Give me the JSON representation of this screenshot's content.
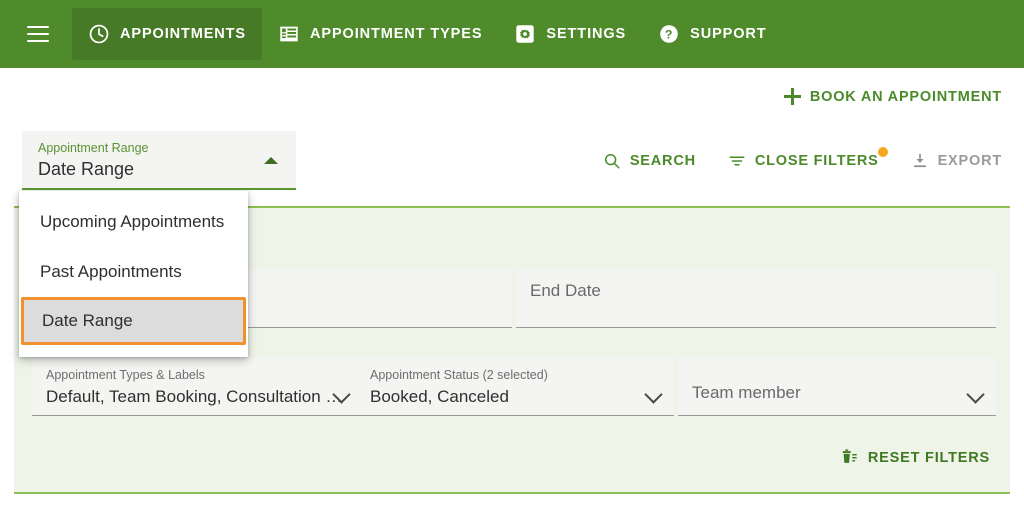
{
  "topnav": {
    "menu_icon": "hamburger-icon",
    "items": [
      {
        "label": "APPOINTMENTS",
        "icon": "clock-icon",
        "active": true
      },
      {
        "label": "APPOINTMENT TYPES",
        "icon": "list-icon",
        "active": false
      },
      {
        "label": "SETTINGS",
        "icon": "gear-icon",
        "active": false
      },
      {
        "label": "SUPPORT",
        "icon": "question-circle-icon",
        "active": false
      }
    ]
  },
  "actions": {
    "book": {
      "label": "BOOK AN APPOINTMENT",
      "icon": "plus-icon"
    },
    "search": {
      "label": "SEARCH",
      "icon": "search-icon"
    },
    "close_filters": {
      "label": "CLOSE FILTERS",
      "icon": "filter-icon",
      "badge": true
    },
    "export": {
      "label": "EXPORT",
      "icon": "download-icon",
      "disabled": true
    },
    "reset_filters": {
      "label": "RESET FILTERS",
      "icon": "trash-list-icon"
    }
  },
  "range_select": {
    "label": "Appointment Range",
    "value": "Date Range",
    "expanded": true,
    "caret_icon": "caret-up-icon",
    "options": [
      {
        "label": "Upcoming Appointments",
        "selected": false
      },
      {
        "label": "Past Appointments",
        "selected": false
      },
      {
        "label": "Date Range",
        "selected": true
      }
    ]
  },
  "filters": {
    "start_date": {
      "label": "",
      "value": "",
      "placeholder": ""
    },
    "end_date": {
      "label": "",
      "value": "",
      "placeholder": "End Date"
    },
    "types": {
      "label": "Appointment Types & Labels",
      "value": "Default, Team Booking, Consultation P…",
      "chevron_icon": "chevron-down-icon"
    },
    "status": {
      "label": "Appointment Status (2 selected)",
      "value": "Booked, Canceled",
      "chevron_icon": "chevron-down-icon"
    },
    "team": {
      "label": "",
      "placeholder": "Team member",
      "chevron_icon": "chevron-down-icon"
    }
  },
  "colors": {
    "brand_green": "#508b2b",
    "active_tab_green": "#477a26",
    "link_green": "#4b8a2a",
    "panel_bg": "#eef4e7",
    "panel_border": "#8cc051",
    "highlight_orange": "#f0912d",
    "badge_orange": "#f5a623",
    "field_bg": "#f4f4f2"
  }
}
